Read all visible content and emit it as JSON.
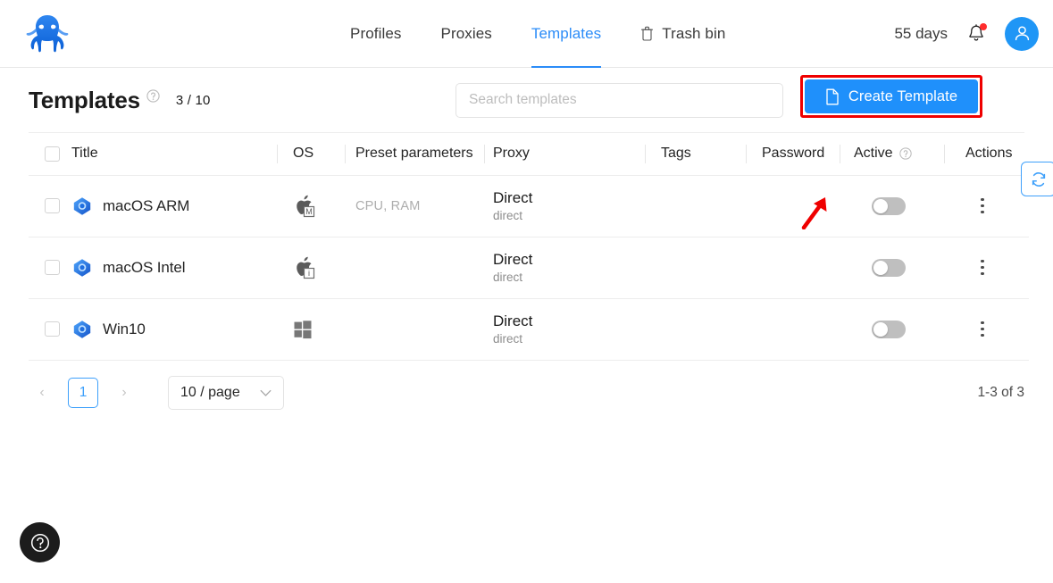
{
  "nav": {
    "logo_alt": "octo-logo",
    "tabs": [
      {
        "label": "Profiles",
        "active": false,
        "icon": ""
      },
      {
        "label": "Proxies",
        "active": false,
        "icon": ""
      },
      {
        "label": "Templates",
        "active": true,
        "icon": ""
      },
      {
        "label": "Trash bin",
        "active": false,
        "icon": "trash-icon"
      }
    ],
    "days": "55 days",
    "notification_dot": true
  },
  "toolbar": {
    "title": "Templates",
    "count": "3 / 10",
    "search_placeholder": "Search templates",
    "search_value": "",
    "create_label": "Create Template",
    "refresh_label": "Refresh"
  },
  "table": {
    "headers": [
      "Title",
      "OS",
      "Preset parameters",
      "Proxy",
      "Tags",
      "Password",
      "Active",
      "Actions"
    ],
    "rows": [
      {
        "title": "macOS ARM",
        "os": "apple-m-icon",
        "preset": "CPU, RAM",
        "proxy_main": "Direct",
        "proxy_sub": "direct",
        "tags": "",
        "password": "",
        "active": false
      },
      {
        "title": "macOS Intel",
        "os": "apple-intel-icon",
        "preset": "",
        "proxy_main": "Direct",
        "proxy_sub": "direct",
        "tags": "",
        "password": "",
        "active": false
      },
      {
        "title": "Win10",
        "os": "windows-icon",
        "preset": "",
        "proxy_main": "Direct",
        "proxy_sub": "direct",
        "tags": "",
        "password": "",
        "active": false
      }
    ]
  },
  "pagination": {
    "prev": "‹",
    "page": "1",
    "next": "›",
    "page_size": "10 / page",
    "total": "1-3 of 3"
  },
  "colors": {
    "accent": "#1f90fb",
    "highlight": "#ef0000",
    "toggle_off": "#bfbfbf",
    "muted_text": "#8c8c8c"
  }
}
